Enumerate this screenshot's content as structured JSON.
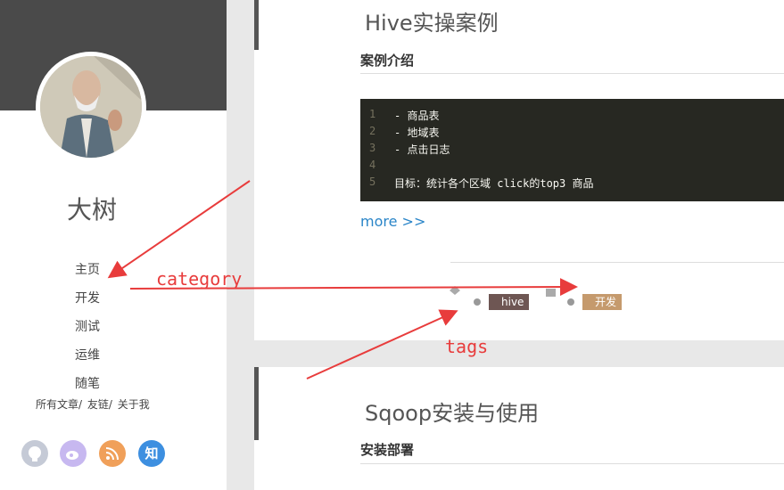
{
  "sidebar": {
    "author": "大树",
    "nav": [
      "主页",
      "开发",
      "测试",
      "运维",
      "随笔"
    ],
    "links": [
      "所有文章/",
      "友链/",
      "关于我"
    ],
    "social": [
      {
        "icon": "github-icon",
        "color": "#c5cad6"
      },
      {
        "icon": "weibo-icon",
        "color": "#c7b8f0"
      },
      {
        "icon": "rss-icon",
        "color": "#f0a05a"
      },
      {
        "icon": "zhihu-icon",
        "color": "#3d8fe0",
        "label": "知"
      }
    ]
  },
  "posts": [
    {
      "title": "Hive实操案例",
      "section": "案例介绍",
      "code": [
        {
          "n": "1",
          "text": "- 商品表"
        },
        {
          "n": "2",
          "text": "- 地域表"
        },
        {
          "n": "3",
          "text": "- 点击日志"
        },
        {
          "n": "4",
          "text": ""
        },
        {
          "n": "5",
          "text": "目标：统计各个区域 click的top3 商品"
        }
      ],
      "more": "more >>",
      "tag": "hive",
      "category": "开发"
    },
    {
      "title": "Sqoop安装与使用",
      "section": "安装部署"
    }
  ],
  "annotations": {
    "category": "category",
    "tags": "tags",
    "arrow_color": "#e83c3c"
  }
}
